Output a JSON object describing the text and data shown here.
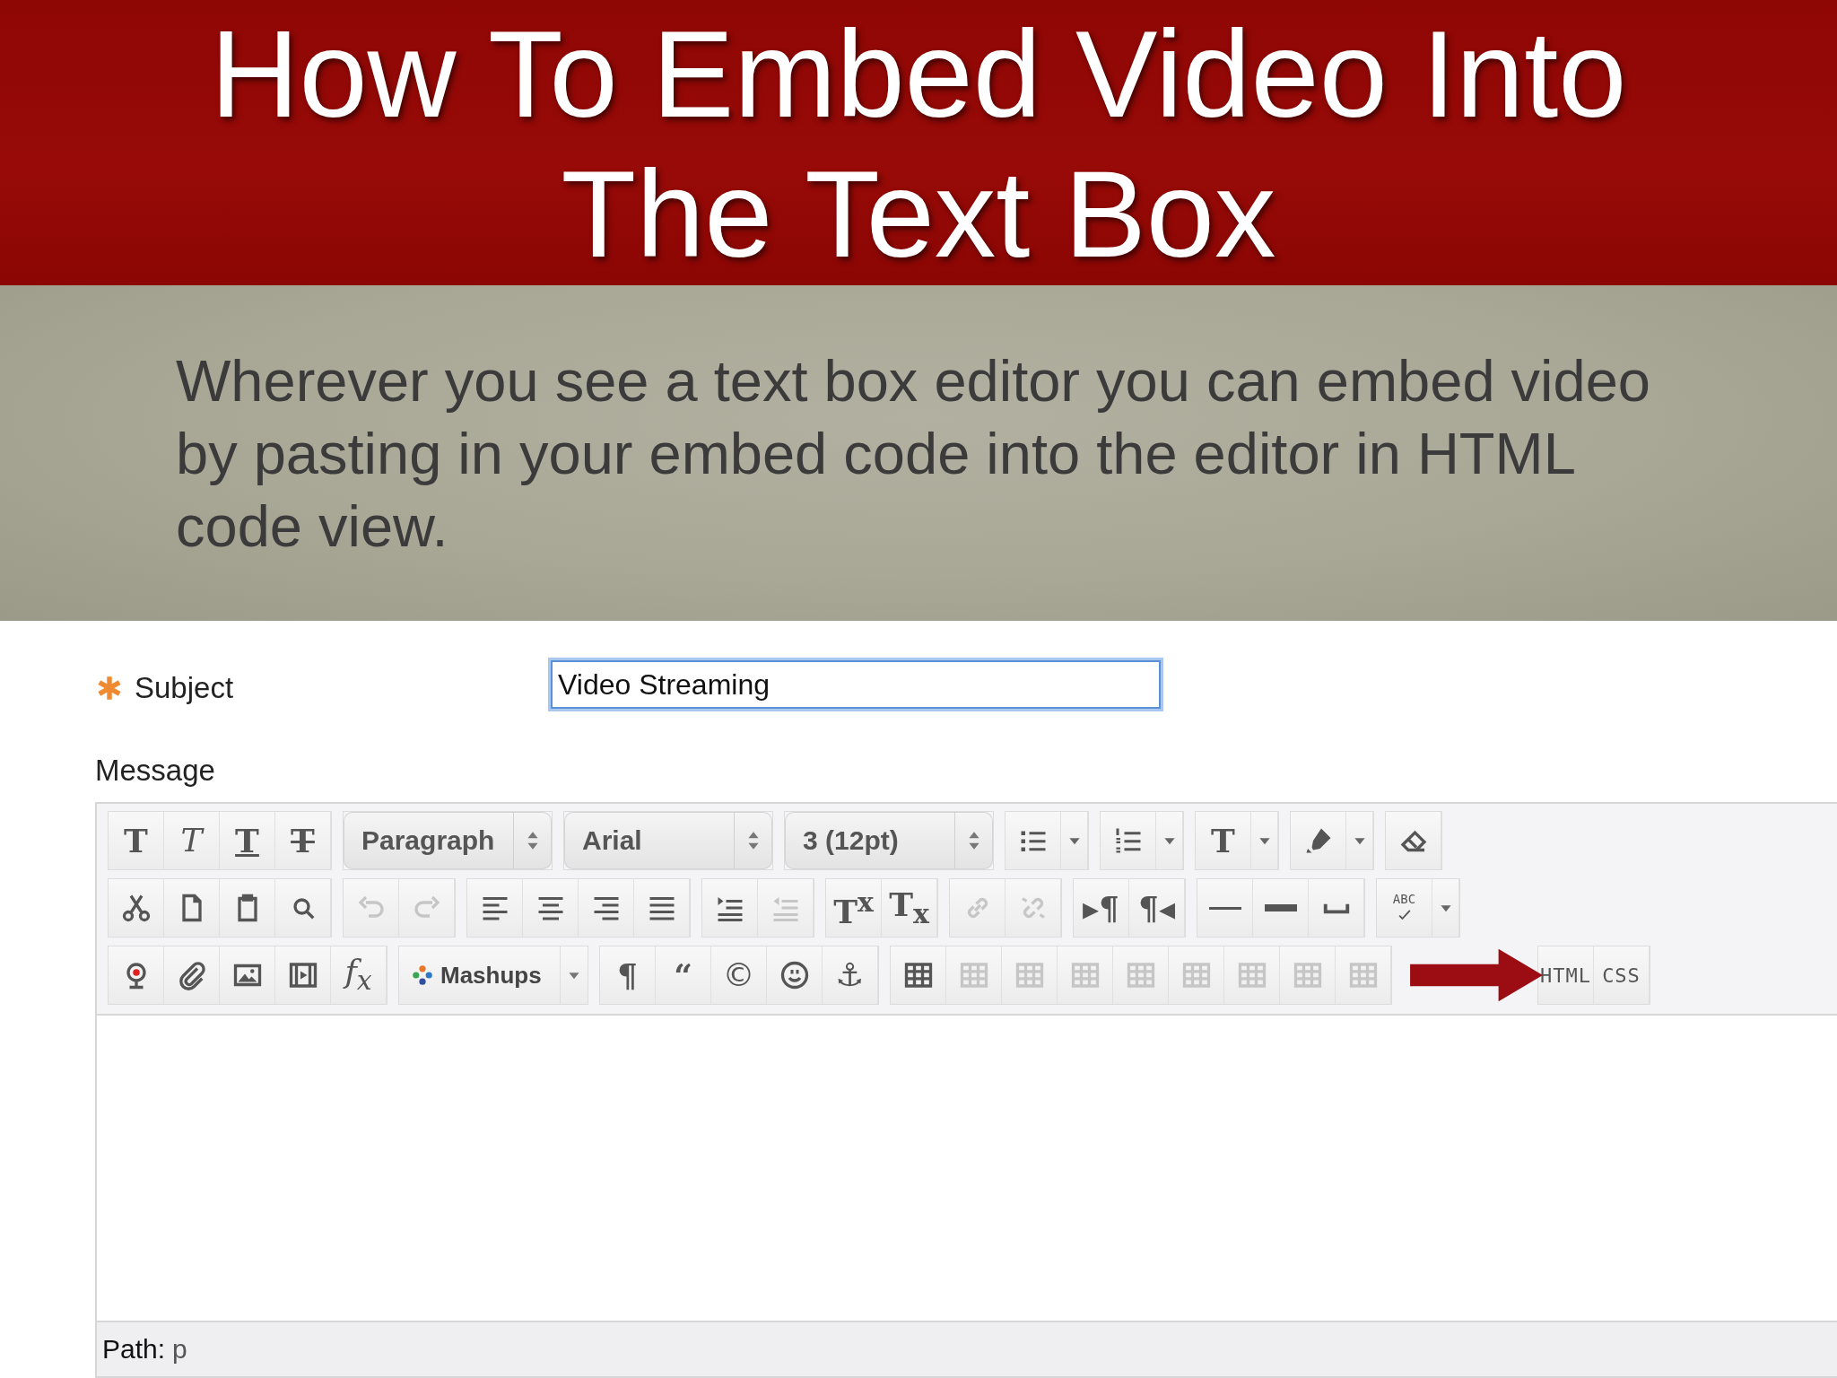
{
  "slide": {
    "title_lines": [
      "How To Embed Video Into",
      "The Text Box"
    ],
    "body": "Wherever you see a text box editor you can embed video by pasting in your embed code into the editor in HTML code view."
  },
  "form": {
    "subject": {
      "label": "Subject",
      "required": true,
      "value": "Video Streaming",
      "focused": true
    },
    "message_label": "Message"
  },
  "toolbar": {
    "rows": [
      {
        "groups": [
          {
            "items": [
              {
                "kind": "button",
                "glyph": "T",
                "disabled": false
              },
              {
                "kind": "button",
                "glyph": "T",
                "disabled": false
              },
              {
                "kind": "button",
                "glyph": "T",
                "disabled": false
              },
              {
                "kind": "button",
                "glyph": "T",
                "disabled": false
              }
            ]
          },
          {
            "items": [
              {
                "kind": "select",
                "value": "Paragraph"
              }
            ]
          },
          {
            "items": [
              {
                "kind": "select",
                "value": "Arial"
              }
            ]
          },
          {
            "items": [
              {
                "kind": "select",
                "value": "3 (12pt)"
              }
            ]
          },
          {
            "items": [
              {
                "kind": "split",
                "disabled": false
              }
            ]
          },
          {
            "items": [
              {
                "kind": "split",
                "disabled": false
              }
            ]
          },
          {
            "items": [
              {
                "kind": "split",
                "glyph": "T",
                "disabled": false
              }
            ]
          },
          {
            "items": [
              {
                "kind": "split",
                "disabled": false
              }
            ]
          },
          {
            "items": [
              {
                "kind": "button",
                "disabled": false
              }
            ]
          }
        ]
      },
      {
        "groups": [
          {
            "items": [
              {
                "kind": "button",
                "disabled": false
              },
              {
                "kind": "button",
                "disabled": false
              },
              {
                "kind": "button",
                "disabled": false
              },
              {
                "kind": "button",
                "disabled": false
              }
            ]
          },
          {
            "items": [
              {
                "kind": "button",
                "disabled": true
              },
              {
                "kind": "button",
                "disabled": true
              }
            ]
          },
          {
            "items": [
              {
                "kind": "button",
                "disabled": false
              },
              {
                "kind": "button",
                "disabled": false
              },
              {
                "kind": "button",
                "disabled": false
              },
              {
                "kind": "button",
                "disabled": false
              }
            ]
          },
          {
            "items": [
              {
                "kind": "button",
                "disabled": false
              },
              {
                "kind": "button",
                "disabled": true
              }
            ]
          },
          {
            "items": [
              {
                "kind": "button",
                "glyph": "T$^{x}$",
                "disabled": false
              },
              {
                "kind": "button",
                "glyph": "T$_{x}$",
                "disabled": false
              }
            ]
          },
          {
            "items": [
              {
                "kind": "button",
                "disabled": true
              },
              {
                "kind": "button",
                "disabled": true
              }
            ]
          },
          {
            "items": [
              {
                "kind": "button",
                "glyph": "▸¶",
                "disabled": false
              },
              {
                "kind": "button",
                "glyph": "¶◂",
                "disabled": false
              }
            ]
          },
          {
            "items": [
              {
                "kind": "button",
                "disabled": false
              },
              {
                "kind": "button",
                "disabled": false
              },
              {
                "kind": "button",
                "disabled": false
              }
            ]
          },
          {
            "items": [
              {
                "kind": "split",
                "glyph": "ABC",
                "disabled": false
              }
            ]
          }
        ]
      },
      {
        "groups": [
          {
            "items": [
              {
                "kind": "button",
                "disabled": false
              },
              {
                "kind": "button",
                "disabled": false
              },
              {
                "kind": "button",
                "disabled": false
              },
              {
                "kind": "button",
                "disabled": false
              },
              {
                "kind": "button",
                "glyph": "f$_{x}$",
                "disabled": false
              }
            ]
          },
          {
            "items": [
              {
                "kind": "menu",
                "label": "Mashups"
              }
            ]
          },
          {
            "items": [
              {
                "kind": "button",
                "glyph": "¶",
                "disabled": false
              },
              {
                "kind": "button",
                "glyph": "“",
                "disabled": false
              },
              {
                "kind": "button",
                "glyph": "©",
                "disabled": false
              },
              {
                "kind": "button",
                "disabled": false
              },
              {
                "kind": "button",
                "glyph": "⚓",
                "disabled": false
              }
            ]
          },
          {
            "items": [
              {
                "kind": "button",
                "disabled": false
              },
              {
                "kind": "button",
                "disabled": true
              },
              {
                "kind": "button",
                "disabled": true
              },
              {
                "kind": "button",
                "disabled": true
              },
              {
                "kind": "button",
                "disabled": true
              },
              {
                "kind": "button",
                "disabled": true
              },
              {
                "kind": "button",
                "disabled": true
              },
              {
                "kind": "button",
                "disabled": true
              },
              {
                "kind": "button",
                "disabled": true
              }
            ]
          },
          {
            "items": [
              {
                "kind": "text",
                "label": "HTML"
              },
              {
                "kind": "text",
                "label": "CSS"
              }
            ]
          }
        ]
      }
    ]
  },
  "path_bar": {
    "label": "Path:",
    "value": "p"
  }
}
